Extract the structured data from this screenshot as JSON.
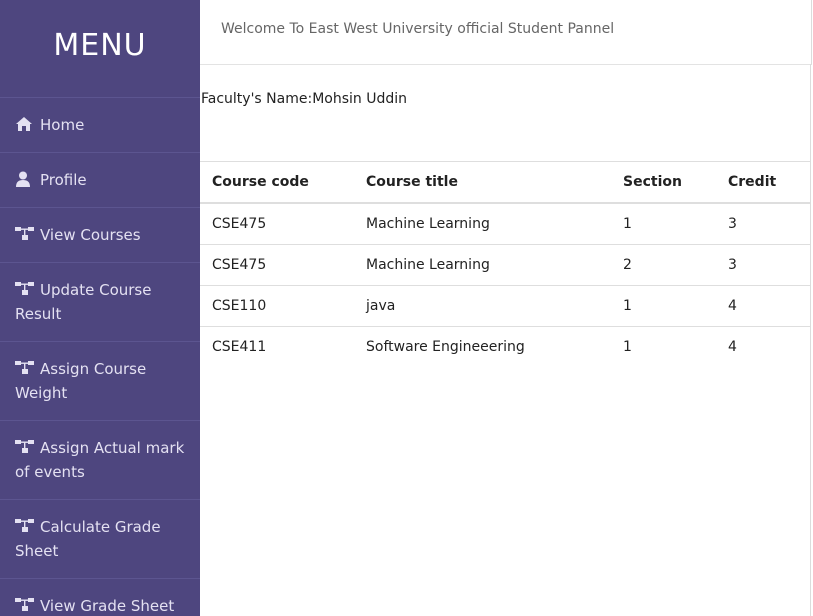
{
  "sidebar": {
    "title": "MENU",
    "items": [
      {
        "label": "Home",
        "icon": "home-icon"
      },
      {
        "label": "Profile",
        "icon": "user-icon"
      },
      {
        "label": "View Courses",
        "icon": "sitemap-icon"
      },
      {
        "label": "Update Course Result",
        "icon": "sitemap-icon"
      },
      {
        "label": "Assign Course Weight",
        "icon": "sitemap-icon"
      },
      {
        "label": "Assign Actual mark of events",
        "icon": "sitemap-icon"
      },
      {
        "label": "Calculate Grade Sheet",
        "icon": "sitemap-icon"
      },
      {
        "label": "View Grade Sheet",
        "icon": "sitemap-icon"
      }
    ]
  },
  "header": {
    "welcome": "Welcome To East West University official Student Pannel"
  },
  "main": {
    "faculty_label": "Faculty's Name:",
    "faculty_name": "Mohsin Uddin",
    "table": {
      "headers": [
        "Course code",
        "Course title",
        "Section",
        "Credit"
      ],
      "rows": [
        [
          "CSE475",
          "Machine Learning",
          "1",
          "3"
        ],
        [
          "CSE475",
          "Machine Learning",
          "2",
          "3"
        ],
        [
          "CSE110",
          "java",
          "1",
          "4"
        ],
        [
          "CSE411",
          "Software Engineeering",
          "1",
          "4"
        ]
      ]
    }
  },
  "colors": {
    "sidebar_bg": "#4e467f",
    "sidebar_text": "#e4e1f2"
  }
}
